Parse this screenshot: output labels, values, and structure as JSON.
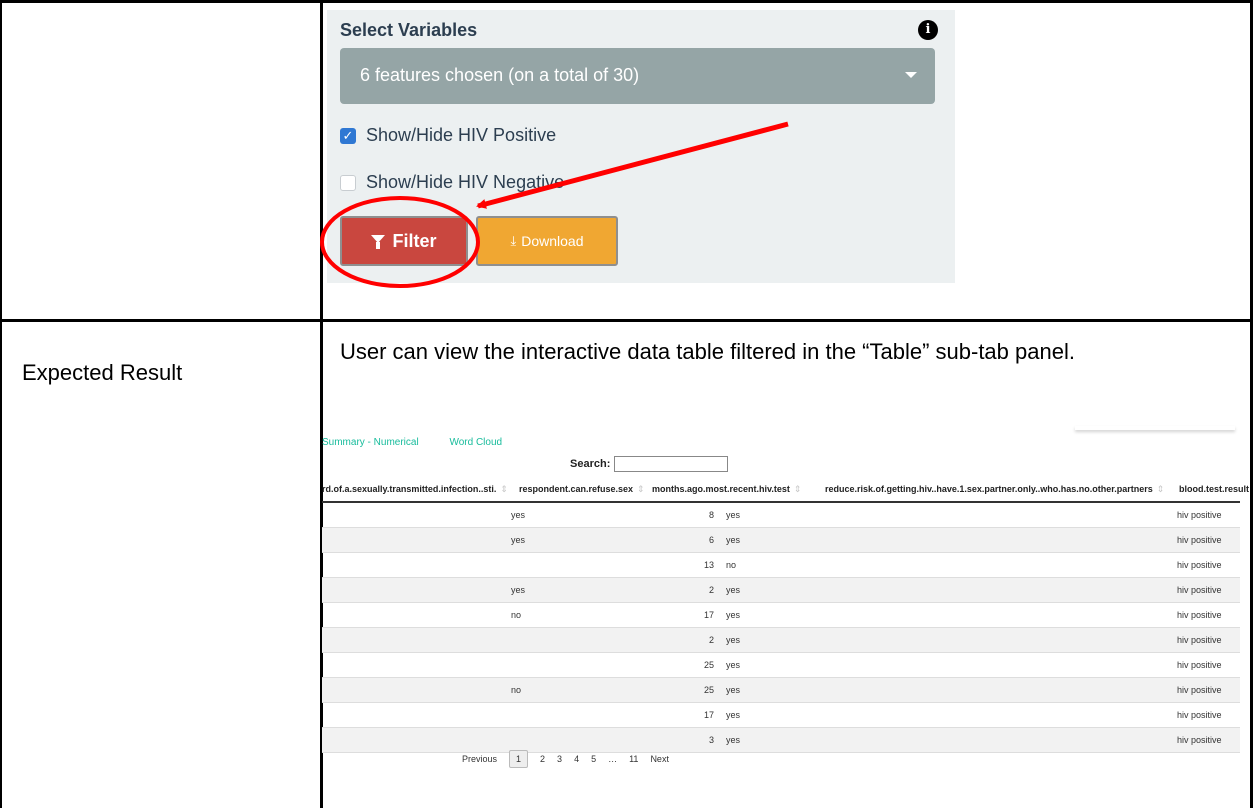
{
  "expected_label": "Expected Result",
  "expected_text": "User can view the interactive data table filtered in the “Table” sub-tab panel.",
  "panel": {
    "title": "Select Variables",
    "info_icon": "info-icon",
    "select_text": "6 features chosen (on a total of 30)",
    "checkboxes": [
      {
        "label": "Show/Hide HIV Positive",
        "checked": true
      },
      {
        "label": "Show/Hide HIV Negative",
        "checked": false
      }
    ],
    "filter_label": "Filter",
    "download_label": "Download"
  },
  "annotation": {
    "color": "#ff0000"
  },
  "tabs": [
    "Summary - Numerical",
    "Word Cloud"
  ],
  "search_label": "Search:",
  "table": {
    "columns": [
      "rd.of.a.sexually.transmitted.infection..sti.",
      "respondent.can.refuse.sex",
      "months.ago.most.recent.hiv.test",
      "reduce.risk.of.getting.hiv..have.1.sex.partner.only..who.has.no.other.partners",
      "blood.test.result"
    ],
    "rows": [
      {
        "refuse": "yes",
        "months": "8",
        "reduce": "yes",
        "blood": "hiv positive"
      },
      {
        "refuse": "yes",
        "months": "6",
        "reduce": "yes",
        "blood": "hiv positive"
      },
      {
        "refuse": "",
        "months": "13",
        "reduce": "no",
        "blood": "hiv positive"
      },
      {
        "refuse": "yes",
        "months": "2",
        "reduce": "yes",
        "blood": "hiv positive"
      },
      {
        "refuse": "no",
        "months": "17",
        "reduce": "yes",
        "blood": "hiv positive"
      },
      {
        "refuse": "",
        "months": "2",
        "reduce": "yes",
        "blood": "hiv positive"
      },
      {
        "refuse": "",
        "months": "25",
        "reduce": "yes",
        "blood": "hiv positive"
      },
      {
        "refuse": "no",
        "months": "25",
        "reduce": "yes",
        "blood": "hiv positive"
      },
      {
        "refuse": "",
        "months": "17",
        "reduce": "yes",
        "blood": "hiv positive"
      },
      {
        "refuse": "",
        "months": "3",
        "reduce": "yes",
        "blood": "hiv positive"
      }
    ]
  },
  "pagination": {
    "previous": "Previous",
    "pages": [
      "1",
      "2",
      "3",
      "4",
      "5",
      "…",
      "11"
    ],
    "current": "1",
    "next": "Next"
  }
}
